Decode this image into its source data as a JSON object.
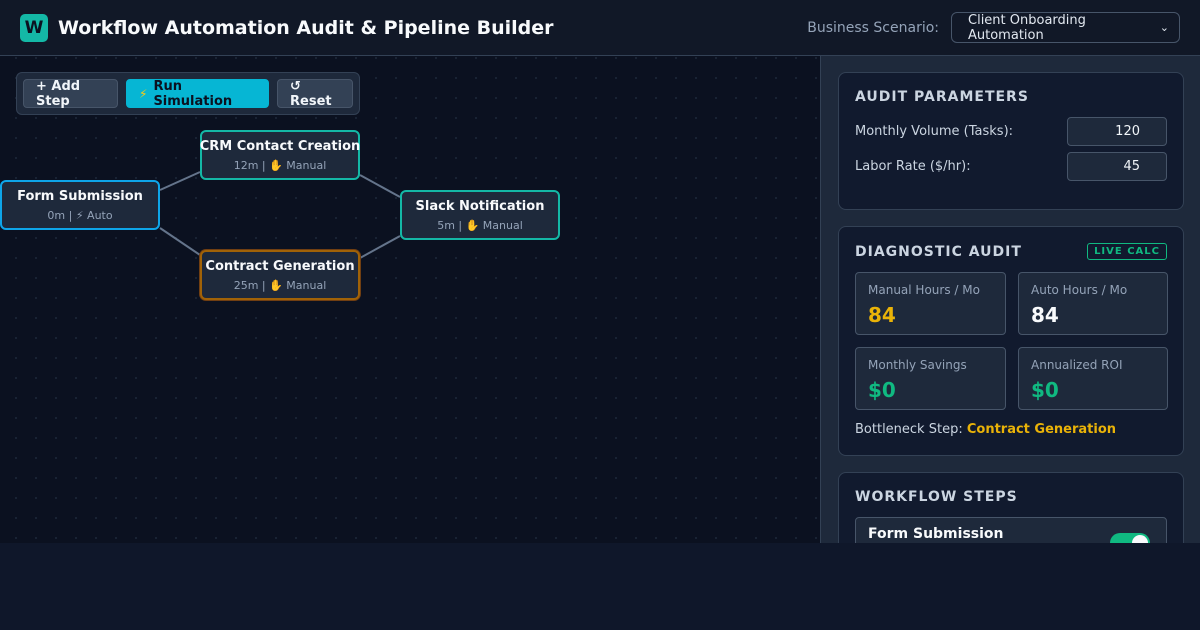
{
  "header": {
    "logo_letter": "W",
    "title": "Workflow Automation Audit & Pipeline Builder",
    "scenario_label": "Business Scenario:",
    "scenario_value": "Client Onboarding Automation"
  },
  "toolbar": {
    "add_label": "+ Add Step",
    "run_label": "Run Simulation",
    "reset_label": "↺ Reset"
  },
  "nodes": [
    {
      "title": "Form Submission",
      "meta": "0m | ⚡ Auto"
    },
    {
      "title": "CRM Contact Creation",
      "meta": "12m | ✋ Manual"
    },
    {
      "title": "Contract Generation",
      "meta": "25m | ✋ Manual"
    },
    {
      "title": "Slack Notification",
      "meta": "5m | ✋ Manual"
    }
  ],
  "audit": {
    "title": "AUDIT PARAMETERS",
    "volume_label": "Monthly Volume (Tasks):",
    "volume_value": "120",
    "rate_label": "Labor Rate ($/hr):",
    "rate_value": "45"
  },
  "diagnostic": {
    "title": "DIAGNOSTIC AUDIT",
    "badge": "LIVE CALC",
    "manual_label": "Manual Hours / Mo",
    "manual_value": "84",
    "auto_label": "Auto Hours / Mo",
    "auto_value": "84",
    "savings_label": "Monthly Savings",
    "savings_value": "$0",
    "roi_label": "Annualized ROI",
    "roi_value": "$0",
    "bottleneck_label": "Bottleneck Step:",
    "bottleneck_value": "Contract Generation"
  },
  "steps": {
    "title": "WORKFLOW STEPS",
    "items": [
      {
        "name": "Form Submission",
        "enabled": true
      }
    ]
  },
  "colors": {
    "accent": "#14b8a6",
    "primary_button": "#06b6d4",
    "bottleneck": "#eab308",
    "success": "#10b981"
  }
}
